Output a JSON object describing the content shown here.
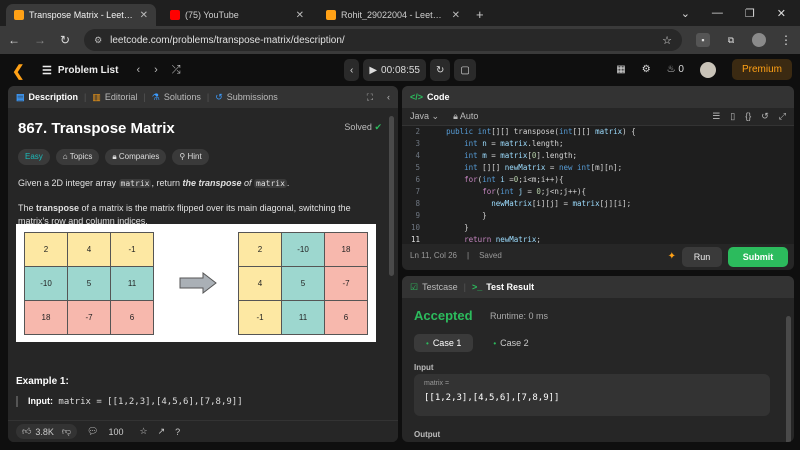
{
  "browser": {
    "tabs": [
      {
        "title": "Transpose Matrix - LeetCode",
        "color": "#ffa116",
        "active": true
      },
      {
        "title": "(75) YouTube",
        "color": "#ff0000",
        "active": false
      },
      {
        "title": "Rohit_29022004 - LeetCode Pr...",
        "color": "#ffa116",
        "active": false
      }
    ],
    "url": "leetcode.com/problems/transpose-matrix/description/"
  },
  "nav": {
    "problem_list": "Problem List",
    "timer": "00:08:55",
    "streak": "0",
    "premium": "Premium"
  },
  "description": {
    "tabs": [
      "Description",
      "Editorial",
      "Solutions",
      "Submissions"
    ],
    "title": "867. Transpose Matrix",
    "solved": "Solved",
    "chips": [
      "Easy",
      "Topics",
      "Companies",
      "Hint"
    ],
    "p1_pre": "Given a 2D integer array ",
    "p1_code1": "matrix",
    "p1_mid": ", return ",
    "p1_bold": "the transpose",
    "p1_of": " of ",
    "p1_code2": "matrix",
    "p1_end": ".",
    "p2_pre": "The ",
    "p2_bold": "transpose",
    "p2_rest": " of a matrix is the matrix flipped over its main diagonal, switching the matrix's row and column indices.",
    "matrix_before": [
      [
        "2",
        "4",
        "-1"
      ],
      [
        "-10",
        "5",
        "11"
      ],
      [
        "18",
        "-7",
        "6"
      ]
    ],
    "matrix_after": [
      [
        "2",
        "-10",
        "18"
      ],
      [
        "4",
        "5",
        "-7"
      ],
      [
        "-1",
        "11",
        "6"
      ]
    ],
    "example_title": "Example 1:",
    "example_input_label": "Input:",
    "example_input_value": " matrix = [[1,2,3],[4,5,6],[7,8,9]]",
    "likes": "3.8K",
    "comments": "100"
  },
  "code": {
    "title": "Code",
    "language": "Java",
    "mode": "Auto",
    "status_pos": "Ln 11, Col 26",
    "status_saved": "Saved",
    "run": "Run",
    "submit": "Submit"
  },
  "result": {
    "tabs": [
      "Testcase",
      "Test Result"
    ],
    "verdict": "Accepted",
    "runtime": "Runtime: 0 ms",
    "cases": [
      "Case 1",
      "Case 2"
    ],
    "input_label": "Input",
    "var_name": "matrix =",
    "var_value": "[[1,2,3],[4,5,6],[7,8,9]]",
    "output_label": "Output"
  }
}
